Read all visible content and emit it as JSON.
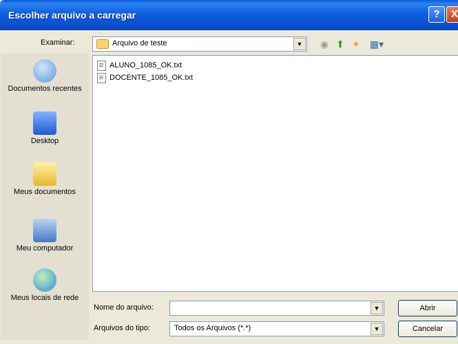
{
  "title": "Escolher arquivo a carregar",
  "title_buttons": {
    "help": "?",
    "close": "X"
  },
  "lookin": {
    "label": "Examinar:",
    "value": "Arquivo de teste"
  },
  "toolbar": {
    "back_icon": "back-icon",
    "up_icon": "up-folder-icon",
    "new_folder_icon": "new-folder-icon",
    "views_icon": "views-menu-icon"
  },
  "places": [
    {
      "label": "Documentos recentes",
      "icon": "recent-documents-icon"
    },
    {
      "label": "Desktop",
      "icon": "desktop-icon"
    },
    {
      "label": "Meus documentos",
      "icon": "my-documents-icon"
    },
    {
      "label": "Meu computador",
      "icon": "my-computer-icon"
    },
    {
      "label": "Meus locais de rede",
      "icon": "network-places-icon"
    }
  ],
  "files": [
    {
      "name": "ALUNO_1085_OK.txt"
    },
    {
      "name": "DOCENTE_1085_OK.txt"
    }
  ],
  "filename": {
    "label": "Nome do arquivo:",
    "value": ""
  },
  "filetype": {
    "label": "Arquivos do tipo:",
    "value": "Todos os Arquivos (*.*)"
  },
  "buttons": {
    "open": "Abrir",
    "cancel": "Cancelar"
  }
}
